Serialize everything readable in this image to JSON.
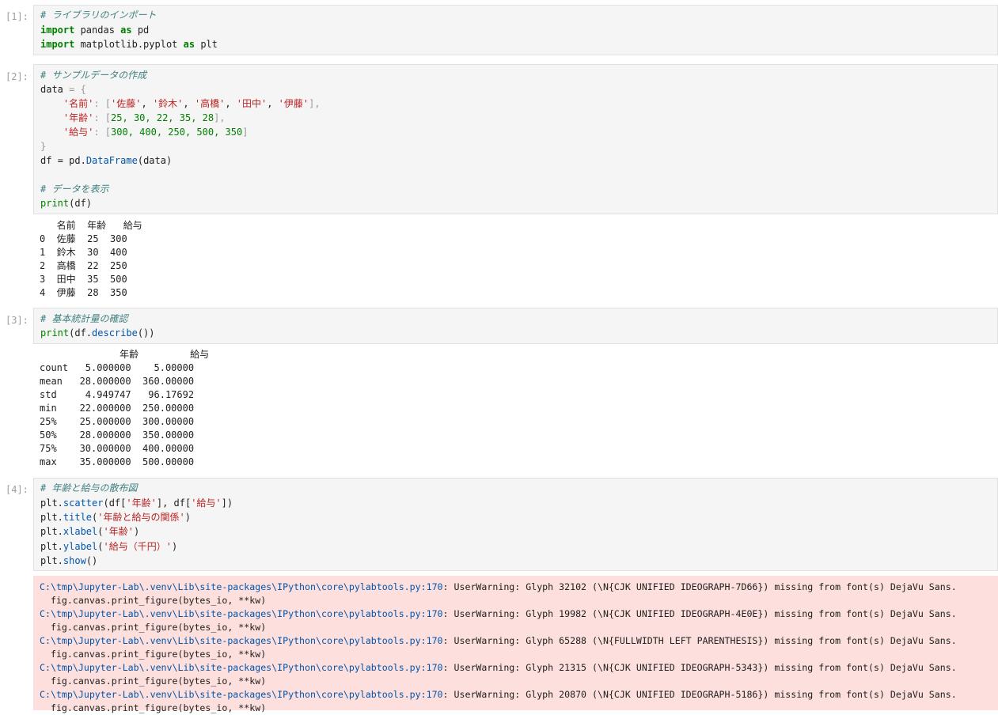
{
  "cells": [
    {
      "prompt": "[1]:",
      "code": {
        "line1": "# ライブラリのインポート",
        "l2_kw1": "import",
        "l2_a": " pandas ",
        "l2_kw2": "as",
        "l2_b": " pd",
        "l3_kw1": "import",
        "l3_a": " matplotlib.pyplot ",
        "l3_kw2": "as",
        "l3_b": " plt"
      }
    },
    {
      "prompt": "[2]:",
      "code": {
        "line1": "# サンプルデータの作成",
        "line2_a": "data ",
        "line2_b": "= {",
        "line3_key": "'名前'",
        "line3_rest": ": [",
        "line3_v1": "'佐藤'",
        "line3_v2": "'鈴木'",
        "line3_v3": "'高橋'",
        "line3_v4": "'田中'",
        "line3_v5": "'伊藤'",
        "line3_end": "],",
        "line4_key": "'年齢'",
        "line4_rest": ": [",
        "line4_vals": "25, 30, 22, 35, 28",
        "line4_end": "],",
        "line5_key": "'給与'",
        "line5_rest": ": [",
        "line5_vals": "300, 400, 250, 500, 350",
        "line5_end": "]",
        "line6": "}",
        "line7_a": "df ",
        "line7_b": "= pd.",
        "line7_c": "DataFrame",
        "line7_d": "(data)",
        "line9": "# データを表示",
        "line10_a": "print",
        "line10_b": "(df)"
      },
      "output": [
        "   名前  年齢   給与",
        "0  佐藤  25  300",
        "1  鈴木  30  400",
        "2  高橋  22  250",
        "3  田中  35  500",
        "4  伊藤  28  350"
      ]
    },
    {
      "prompt": "[3]:",
      "code": {
        "line1": "# 基本統計量の確認",
        "line2_a": "print",
        "line2_b": "(df.",
        "line2_c": "describe",
        "line2_d": "())"
      },
      "output": [
        "              年齢         給与",
        "count   5.000000    5.00000",
        "mean   28.000000  360.00000",
        "std     4.949747   96.17692",
        "min    22.000000  250.00000",
        "25%    25.000000  300.00000",
        "50%    28.000000  350.00000",
        "75%    30.000000  400.00000",
        "max    35.000000  500.00000"
      ]
    },
    {
      "prompt": "[4]:",
      "code": {
        "line1": "# 年齢と給与の散布図",
        "l2_a": "plt.",
        "l2_b": "scatter",
        "l2_c": "(df[",
        "l2_d": "'年齢'",
        "l2_e": "], df[",
        "l2_f": "'給与'",
        "l2_g": "])",
        "l3_a": "plt.",
        "l3_b": "title",
        "l3_c": "(",
        "l3_d": "'年齢と給与の関係'",
        "l3_e": ")",
        "l4_a": "plt.",
        "l4_b": "xlabel",
        "l4_c": "(",
        "l4_d": "'年齢'",
        "l4_e": ")",
        "l5_a": "plt.",
        "l5_b": "ylabel",
        "l5_c": "(",
        "l5_d": "'給与（千円）'",
        "l5_e": ")",
        "l6_a": "plt.",
        "l6_b": "show",
        "l6_c": "()"
      },
      "stderr": [
        {
          "path": "C:\\tmp\\Jupyter-Lab\\.venv\\Lib\\site-packages\\IPython\\core\\pylabtools.py:170",
          "msg": ": UserWarning: Glyph 32102 (\\N{CJK UNIFIED IDEOGRAPH-7D66}) missing from font(s) DejaVu Sans.",
          "cont": "  fig.canvas.print_figure(bytes_io, **kw)"
        },
        {
          "path": "C:\\tmp\\Jupyter-Lab\\.venv\\Lib\\site-packages\\IPython\\core\\pylabtools.py:170",
          "msg": ": UserWarning: Glyph 19982 (\\N{CJK UNIFIED IDEOGRAPH-4E0E}) missing from font(s) DejaVu Sans.",
          "cont": "  fig.canvas.print_figure(bytes_io, **kw)"
        },
        {
          "path": "C:\\tmp\\Jupyter-Lab\\.venv\\Lib\\site-packages\\IPython\\core\\pylabtools.py:170",
          "msg": ": UserWarning: Glyph 65288 (\\N{FULLWIDTH LEFT PARENTHESIS}) missing from font(s) DejaVu Sans.",
          "cont": "  fig.canvas.print_figure(bytes_io, **kw)"
        },
        {
          "path": "C:\\tmp\\Jupyter-Lab\\.venv\\Lib\\site-packages\\IPython\\core\\pylabtools.py:170",
          "msg": ": UserWarning: Glyph 21315 (\\N{CJK UNIFIED IDEOGRAPH-5343}) missing from font(s) DejaVu Sans.",
          "cont": "  fig.canvas.print_figure(bytes_io, **kw)"
        },
        {
          "path": "C:\\tmp\\Jupyter-Lab\\.venv\\Lib\\site-packages\\IPython\\core\\pylabtools.py:170",
          "msg": ": UserWarning: Glyph 20870 (\\N{CJK UNIFIED IDEOGRAPH-5186}) missing from font(s) DejaVu Sans.",
          "cont": "  fig.canvas.print_figure(bytes_io, **kw)"
        }
      ]
    }
  ]
}
